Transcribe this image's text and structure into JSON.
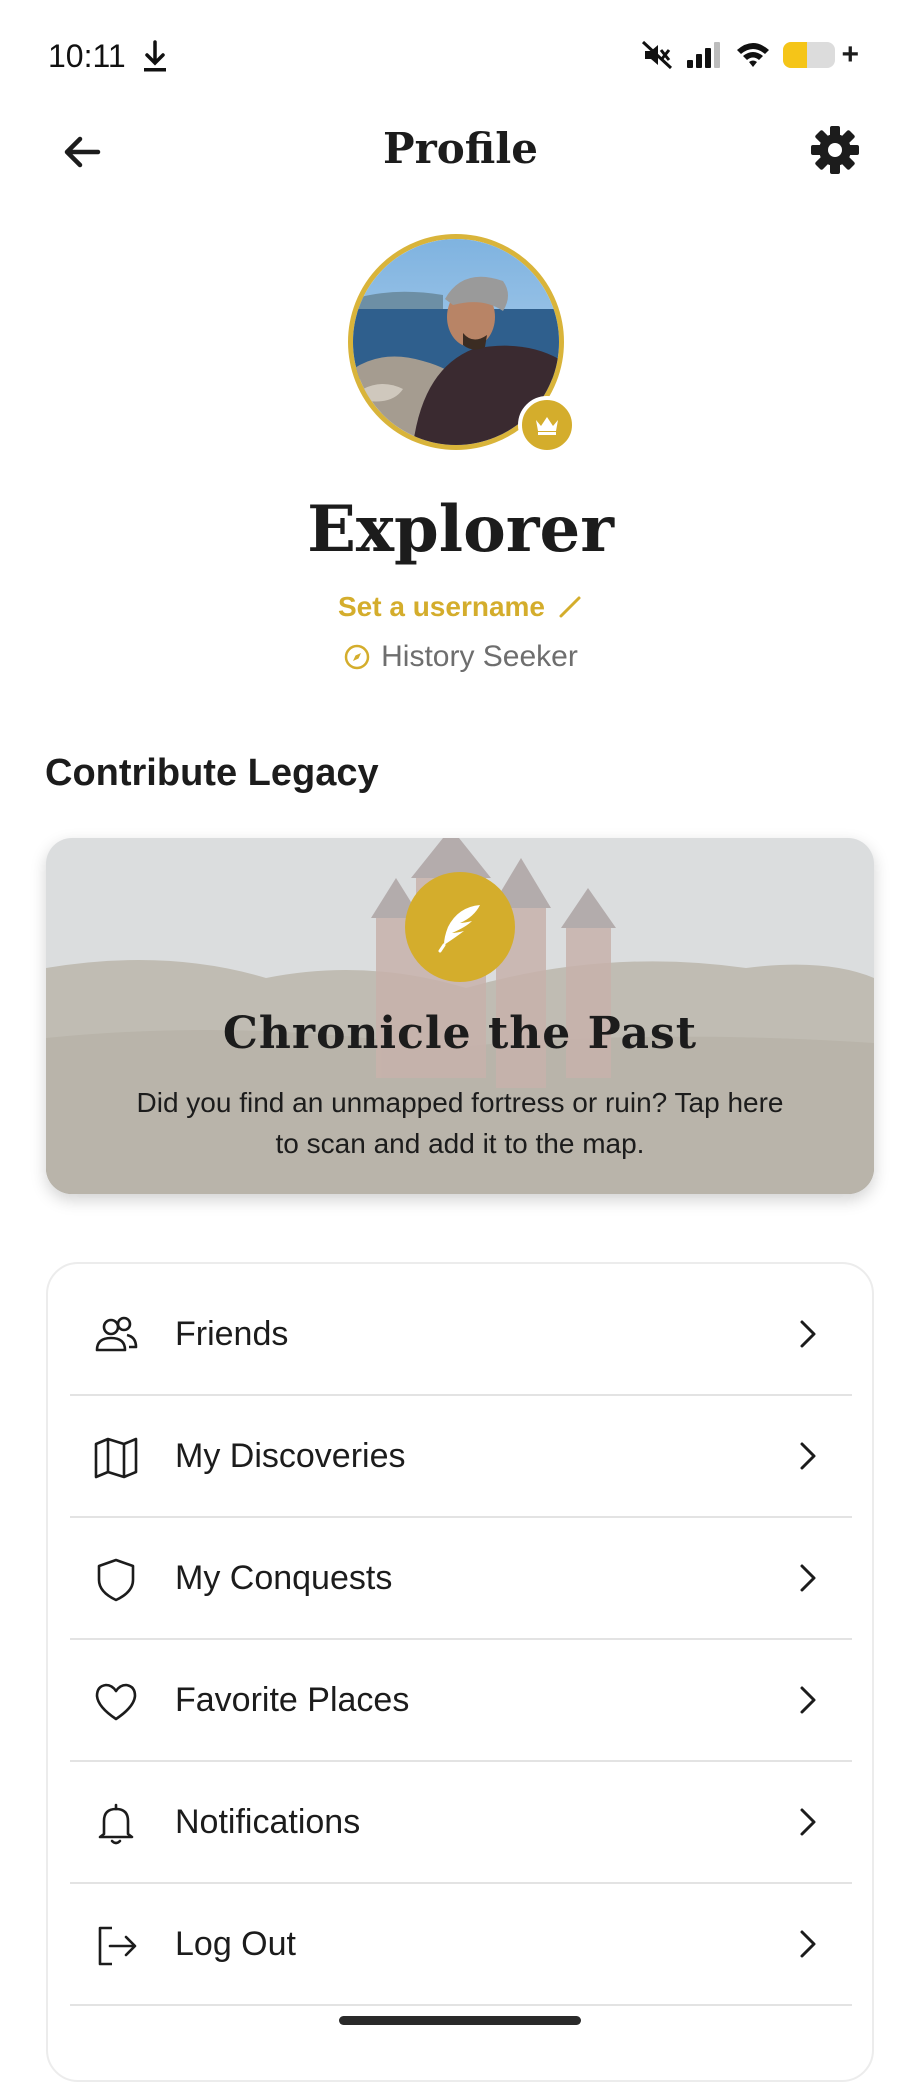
{
  "status_bar": {
    "time": "10:11",
    "battery_level": 0.45,
    "icons": [
      "download-icon",
      "mute-icon",
      "signal-icon",
      "wifi-icon",
      "battery-icon"
    ]
  },
  "header": {
    "title": "Profile",
    "icons": [
      "back-arrow-icon",
      "settings-gear-icon"
    ]
  },
  "profile": {
    "display_name": "Explorer",
    "username_link": "Set a username",
    "rank": "History Seeker",
    "icons": [
      "crown-icon",
      "pencil-icon",
      "compass-icon"
    ]
  },
  "contribute": {
    "section_title": "Contribute Legacy",
    "card_title": "Chronicle the Past",
    "card_description": "Did you find an unmapped fortress or ruin? Tap here to scan and add it to the map.",
    "icon": "quill-icon"
  },
  "menu": {
    "items": [
      {
        "label": "Friends",
        "icon": "friends-icon"
      },
      {
        "label": "My Discoveries",
        "icon": "map-icon"
      },
      {
        "label": "My Conquests",
        "icon": "shield-icon"
      },
      {
        "label": "Favorite Places",
        "icon": "heart-icon"
      },
      {
        "label": "Notifications",
        "icon": "bell-icon"
      },
      {
        "label": "Log Out",
        "icon": "logout-icon"
      }
    ]
  },
  "colors": {
    "accent": "#d4ad2c",
    "text": "#1c1c1c",
    "muted": "#6e6e6e",
    "divider": "#e3e3e3"
  }
}
